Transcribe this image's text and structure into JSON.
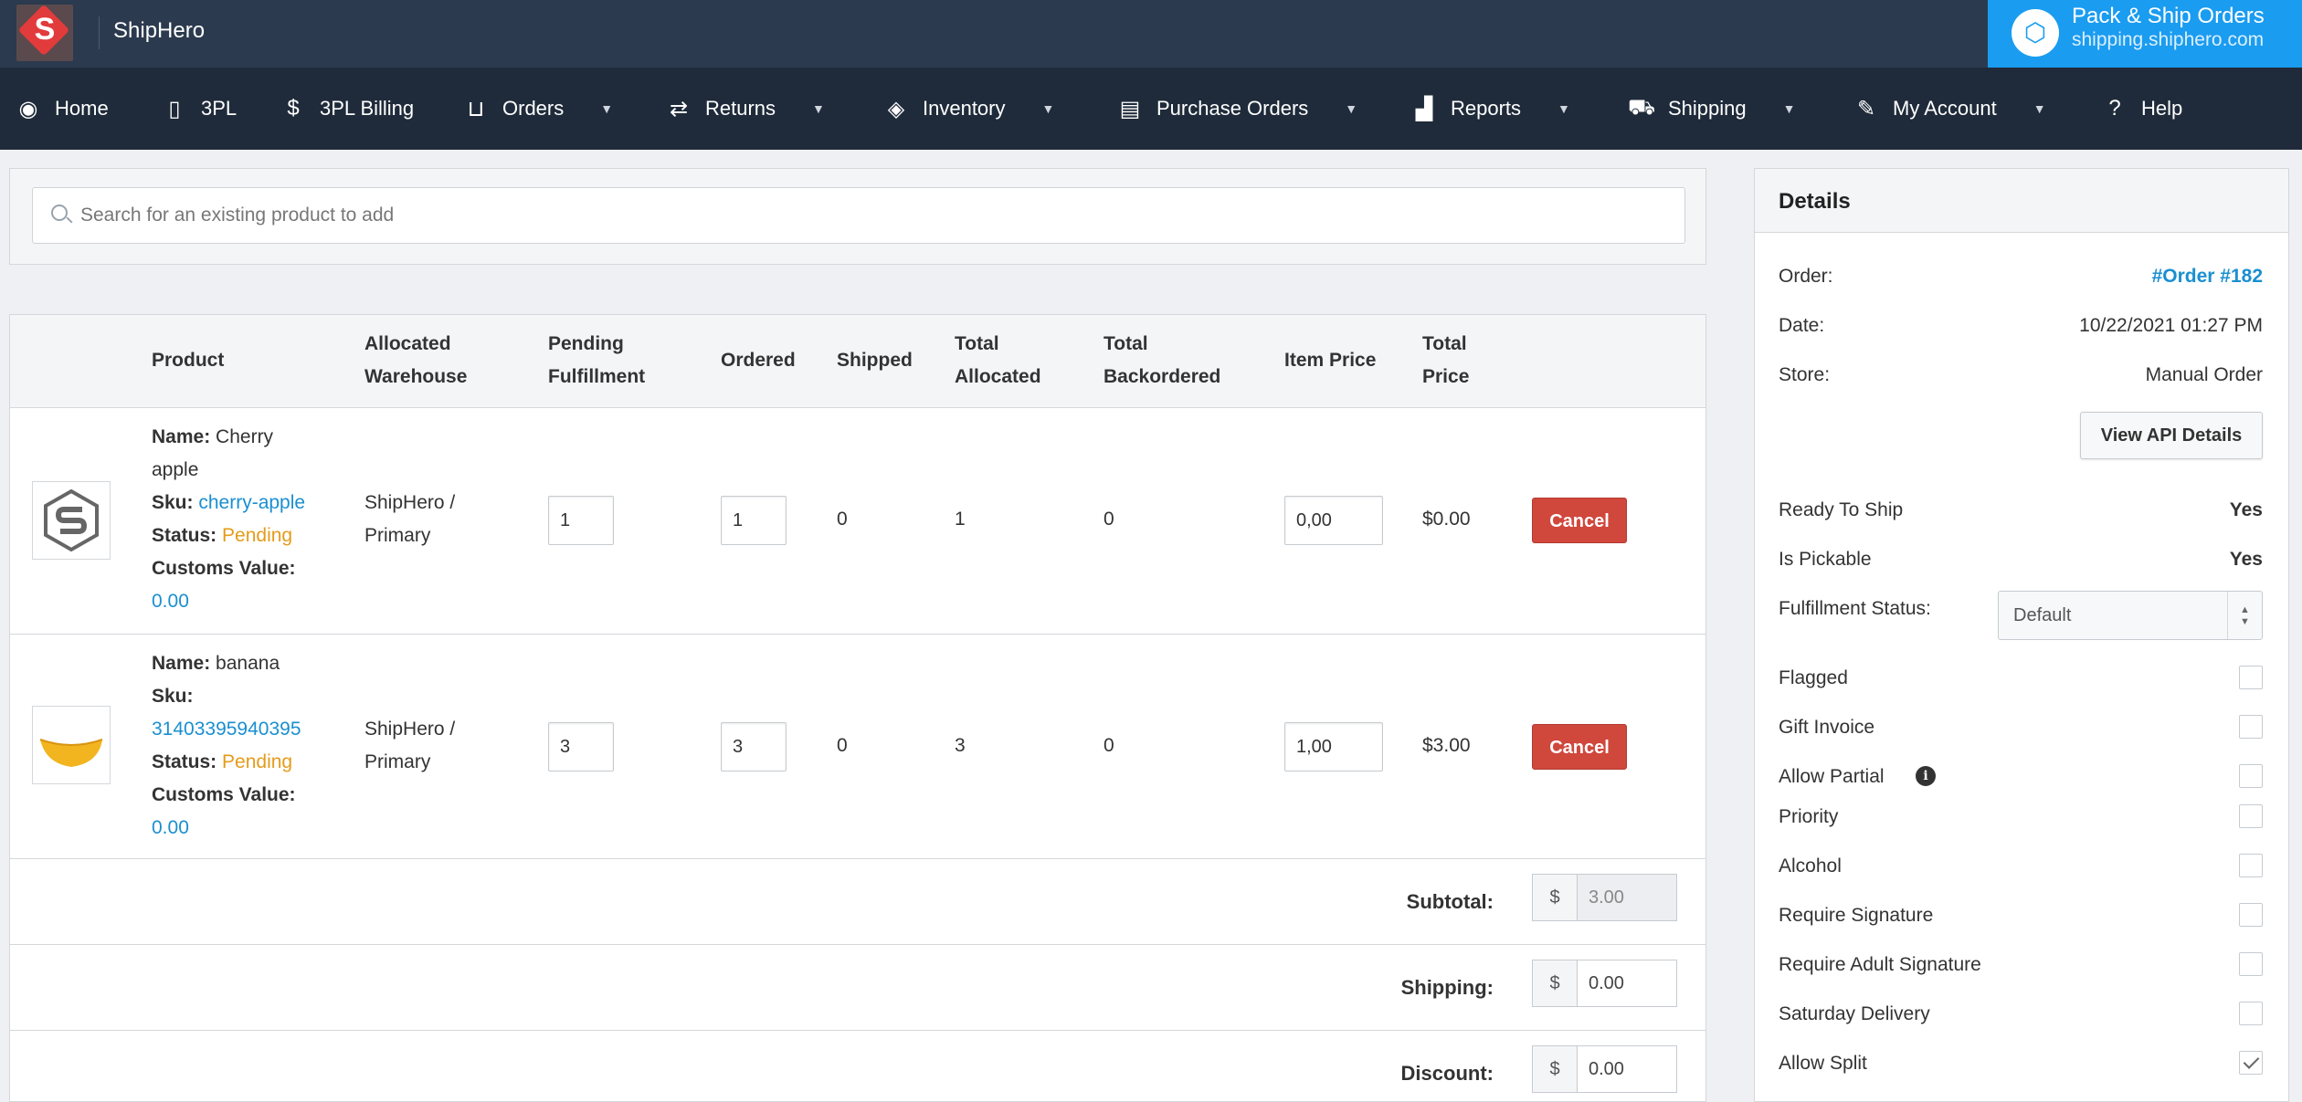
{
  "app": {
    "brand": "ShipHero",
    "pack_title": "Pack & Ship Orders",
    "pack_url": "shipping.shiphero.com"
  },
  "nav": [
    {
      "label": "Home",
      "icon": "dashboard-icon"
    },
    {
      "label": "3PL",
      "icon": "mobile-icon"
    },
    {
      "label": "3PL Billing",
      "icon": "dollar-icon"
    },
    {
      "label": "Orders",
      "icon": "inbox-icon",
      "dropdown": true
    },
    {
      "label": "Returns",
      "icon": "exchange-icon",
      "dropdown": true
    },
    {
      "label": "Inventory",
      "icon": "tags-icon",
      "dropdown": true
    },
    {
      "label": "Purchase Orders",
      "icon": "archive-icon",
      "dropdown": true
    },
    {
      "label": "Reports",
      "icon": "signal-icon",
      "dropdown": true
    },
    {
      "label": "Shipping",
      "icon": "truck-icon",
      "dropdown": true
    },
    {
      "label": "My Account",
      "icon": "wrench-icon",
      "dropdown": true
    },
    {
      "label": "Help",
      "icon": "question-circle-icon"
    }
  ],
  "search": {
    "placeholder": "Search for an existing product to add"
  },
  "table": {
    "headers": {
      "product": "Product",
      "warehouse_1": "Allocated",
      "warehouse_2": "Warehouse",
      "pending_1": "Pending",
      "pending_2": "Fulfillment",
      "ordered": "Ordered",
      "shipped": "Shipped",
      "allocated_1": "Total",
      "allocated_2": "Allocated",
      "backordered_1": "Total",
      "backordered_2": "Backordered",
      "item_price": "Item Price",
      "total_price_1": "Total",
      "total_price_2": "Price"
    },
    "labels": {
      "name": "Name:",
      "sku": "Sku:",
      "status": "Status:",
      "customs": "Customs Value:",
      "cancel": "Cancel"
    },
    "rows": [
      {
        "name_1": "Cherry",
        "name_2": "apple",
        "sku": "cherry-apple",
        "status": "Pending",
        "customs": "0.00",
        "warehouse_1": "ShipHero /",
        "warehouse_2": "Primary",
        "pending": "1",
        "ordered": "1",
        "shipped": "0",
        "allocated": "1",
        "backordered": "0",
        "item_price": "0,00",
        "total_price": "$0.00"
      },
      {
        "name_1": "banana",
        "sku": "31403395940395",
        "status": "Pending",
        "customs": "0.00",
        "warehouse_1": "ShipHero /",
        "warehouse_2": "Primary",
        "pending": "3",
        "ordered": "3",
        "shipped": "0",
        "allocated": "3",
        "backordered": "0",
        "item_price": "1,00",
        "total_price": "$3.00"
      }
    ],
    "summary": {
      "currency": "$",
      "subtotal_label": "Subtotal:",
      "subtotal": "3.00",
      "shipping_label": "Shipping:",
      "shipping": "0.00",
      "discount_label": "Discount:",
      "discount": "0.00"
    }
  },
  "details": {
    "title": "Details",
    "order_label": "Order:",
    "order_value": "#Order #182",
    "date_label": "Date:",
    "date_value": "10/22/2021 01:27 PM",
    "store_label": "Store:",
    "store_value": "Manual Order",
    "api_button": "View API Details",
    "ready_label": "Ready To Ship",
    "ready_value": "Yes",
    "pickable_label": "Is Pickable",
    "pickable_value": "Yes",
    "fulfillment_label": "Fulfillment Status:",
    "fulfillment_value": "Default",
    "flags": [
      {
        "label": "Flagged",
        "checked": false
      },
      {
        "label": "Gift Invoice",
        "checked": false
      },
      {
        "label": "Allow Partial",
        "checked": false,
        "info": true
      },
      {
        "label": "Priority",
        "checked": false
      },
      {
        "label": "Alcohol",
        "checked": false
      },
      {
        "label": "Require Signature",
        "checked": false
      },
      {
        "label": "Require Adult Signature",
        "checked": false
      },
      {
        "label": "Saturday Delivery",
        "checked": false
      },
      {
        "label": "Allow Split",
        "checked": true
      }
    ]
  }
}
